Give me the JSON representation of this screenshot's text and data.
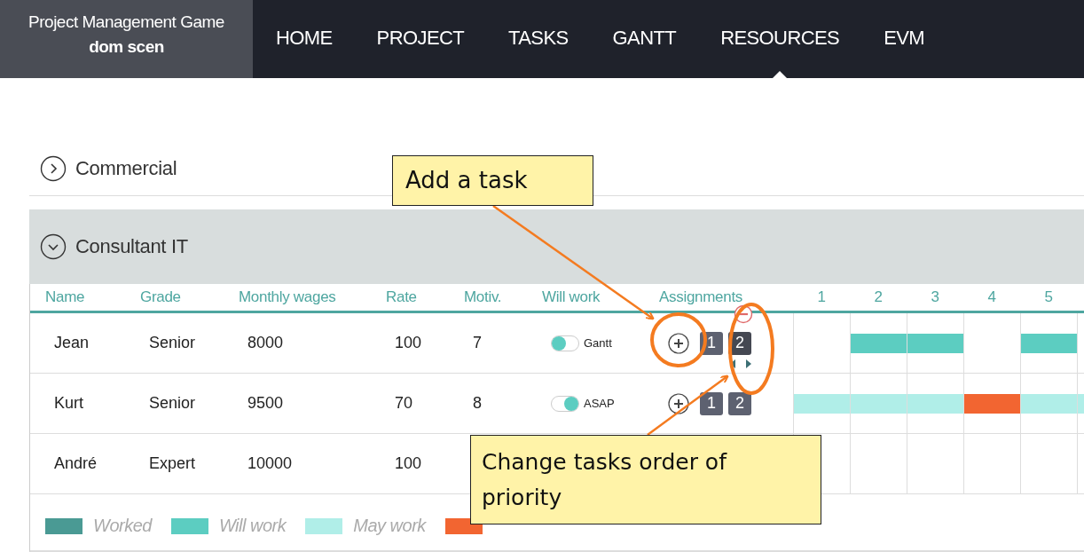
{
  "header": {
    "brand": {
      "title": "Project Management Game",
      "subtitle": "dom scen"
    },
    "nav": [
      {
        "label": "HOME",
        "selected": false
      },
      {
        "label": "PROJECT",
        "selected": false
      },
      {
        "label": "TASKS",
        "selected": false
      },
      {
        "label": "GANTT",
        "selected": false
      },
      {
        "label": "RESOURCES",
        "selected": true
      },
      {
        "label": "EVM",
        "selected": false
      }
    ]
  },
  "groups": [
    {
      "name": "Commercial",
      "expanded": false
    },
    {
      "name": "Consultant IT",
      "expanded": true
    }
  ],
  "table": {
    "columns": [
      "Name",
      "Grade",
      "Monthly wages",
      "Rate",
      "Motiv.",
      "Will work",
      "Assignments"
    ],
    "days": [
      "1",
      "2",
      "3",
      "4",
      "5"
    ],
    "rows": [
      {
        "name": "Jean",
        "grade": "Senior",
        "wages": "8000",
        "rate": "100",
        "motiv": "7",
        "will_work": {
          "label": "Gantt",
          "on": false
        },
        "assignments": [
          {
            "label": "1",
            "selected": false
          },
          {
            "label": "2",
            "selected": true
          }
        ],
        "cells": [
          {
            "kind": "none"
          },
          {
            "kind": "will"
          },
          {
            "kind": "will"
          },
          {
            "kind": "none"
          },
          {
            "kind": "will"
          },
          {
            "kind": "none"
          }
        ]
      },
      {
        "name": "Kurt",
        "grade": "Senior",
        "wages": "9500",
        "rate": "70",
        "motiv": "8",
        "will_work": {
          "label": "ASAP",
          "on": true
        },
        "assignments": [
          {
            "label": "1",
            "selected": false
          },
          {
            "label": "2",
            "selected": false
          }
        ],
        "cells": [
          {
            "kind": "may"
          },
          {
            "kind": "may"
          },
          {
            "kind": "may"
          },
          {
            "kind": "na"
          },
          {
            "kind": "may"
          },
          {
            "kind": "may"
          }
        ]
      },
      {
        "name": "André",
        "grade": "Expert",
        "wages": "10000",
        "rate": "100",
        "cells": [
          {
            "kind": "none"
          },
          {
            "kind": "none"
          },
          {
            "kind": "none"
          },
          {
            "kind": "none"
          },
          {
            "kind": "none"
          },
          {
            "kind": "none"
          }
        ]
      }
    ]
  },
  "legend": [
    {
      "label": "Worked",
      "kind": "worked"
    },
    {
      "label": "Will work",
      "kind": "will"
    },
    {
      "label": "May work",
      "kind": "may"
    },
    {
      "kind": "na"
    }
  ],
  "callouts": [
    {
      "text": "Add a task"
    },
    {
      "text": "Change tasks order of priority"
    }
  ]
}
